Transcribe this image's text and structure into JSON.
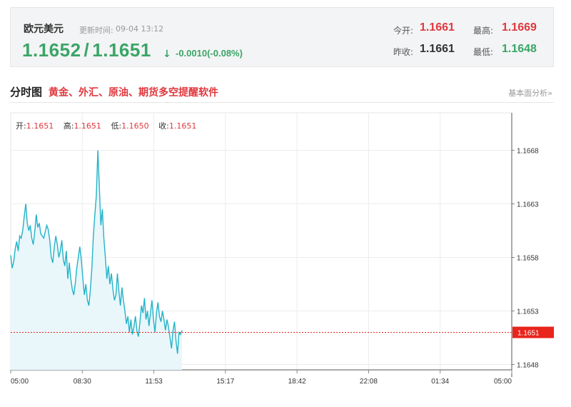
{
  "quote": {
    "name": "欧元美元",
    "update_label": "更新时间:",
    "update_time": "09-04 13:12",
    "bid": "1.1652",
    "ask": "1.1651",
    "arrow": "↓",
    "change": "-0.0010(-0.08%)",
    "open_label": "今开:",
    "open": "1.1661",
    "high_label": "最高:",
    "high": "1.1669",
    "prev_close_label": "昨收:",
    "prev_close": "1.1661",
    "low_label": "最低:",
    "low": "1.1648"
  },
  "section": {
    "title": "分时图",
    "promo": "黄金、外汇、原油、期货多空提醒软件",
    "analysis_link": "基本面分析»"
  },
  "ohlc": {
    "open_label": "开:",
    "open": "1.1651",
    "high_label": "高:",
    "high": "1.1651",
    "low_label": "低:",
    "low": "1.1650",
    "close_label": "收:",
    "close": "1.1651"
  },
  "colors": {
    "up": "#e0383e",
    "down": "#3aa566",
    "line": "#23b3c8",
    "fill": "#e9f7fb",
    "current_marker": "#e8241c"
  },
  "chart_data": {
    "type": "area",
    "x_ticks": [
      "05:00",
      "08:30",
      "11:53",
      "15:17",
      "18:42",
      "22:08",
      "01:34",
      "05:00"
    ],
    "y_ticks": [
      "1.1668",
      "1.1663",
      "1.1658",
      "1.1653",
      "1.1648"
    ],
    "ylim": [
      1.16475,
      1.16715
    ],
    "current_price": "1.1651",
    "series": [
      {
        "values": [
          1.16582,
          1.1657,
          1.16576,
          1.16588,
          1.16595,
          1.16586,
          1.166,
          1.16598,
          1.16605,
          1.16618,
          1.1663,
          1.16612,
          1.16605,
          1.1661,
          1.16598,
          1.16592,
          1.16604,
          1.1662,
          1.16608,
          1.16612,
          1.16602,
          1.166,
          1.16598,
          1.16604,
          1.1661,
          1.16606,
          1.16596,
          1.1658,
          1.16575,
          1.1659,
          1.166,
          1.16592,
          1.1658,
          1.16586,
          1.16596,
          1.16578,
          1.16572,
          1.16586,
          1.1656,
          1.16575,
          1.1656,
          1.1655,
          1.16545,
          1.16556,
          1.1657,
          1.1658,
          1.1659,
          1.16578,
          1.1656,
          1.16545,
          1.16555,
          1.1654,
          1.16535,
          1.1655,
          1.1657,
          1.166,
          1.1662,
          1.16638,
          1.1668,
          1.16645,
          1.1661,
          1.16625,
          1.16598,
          1.1658,
          1.1656,
          1.16572,
          1.16555,
          1.16565,
          1.1655,
          1.1654,
          1.16545,
          1.16565,
          1.16548,
          1.16535,
          1.16552,
          1.1654,
          1.1653,
          1.16518,
          1.16525,
          1.1651,
          1.16522,
          1.16508,
          1.16515,
          1.16525,
          1.16512,
          1.16506,
          1.1652,
          1.16535,
          1.16528,
          1.16542,
          1.16522,
          1.1653,
          1.16516,
          1.16528,
          1.1654,
          1.16522,
          1.1651,
          1.16528,
          1.16538,
          1.16525,
          1.1652,
          1.1653,
          1.16522,
          1.16512,
          1.16522,
          1.16515,
          1.16505,
          1.16495,
          1.16512,
          1.1652,
          1.16502,
          1.1649,
          1.1651,
          1.16508,
          1.16512
        ]
      }
    ]
  }
}
